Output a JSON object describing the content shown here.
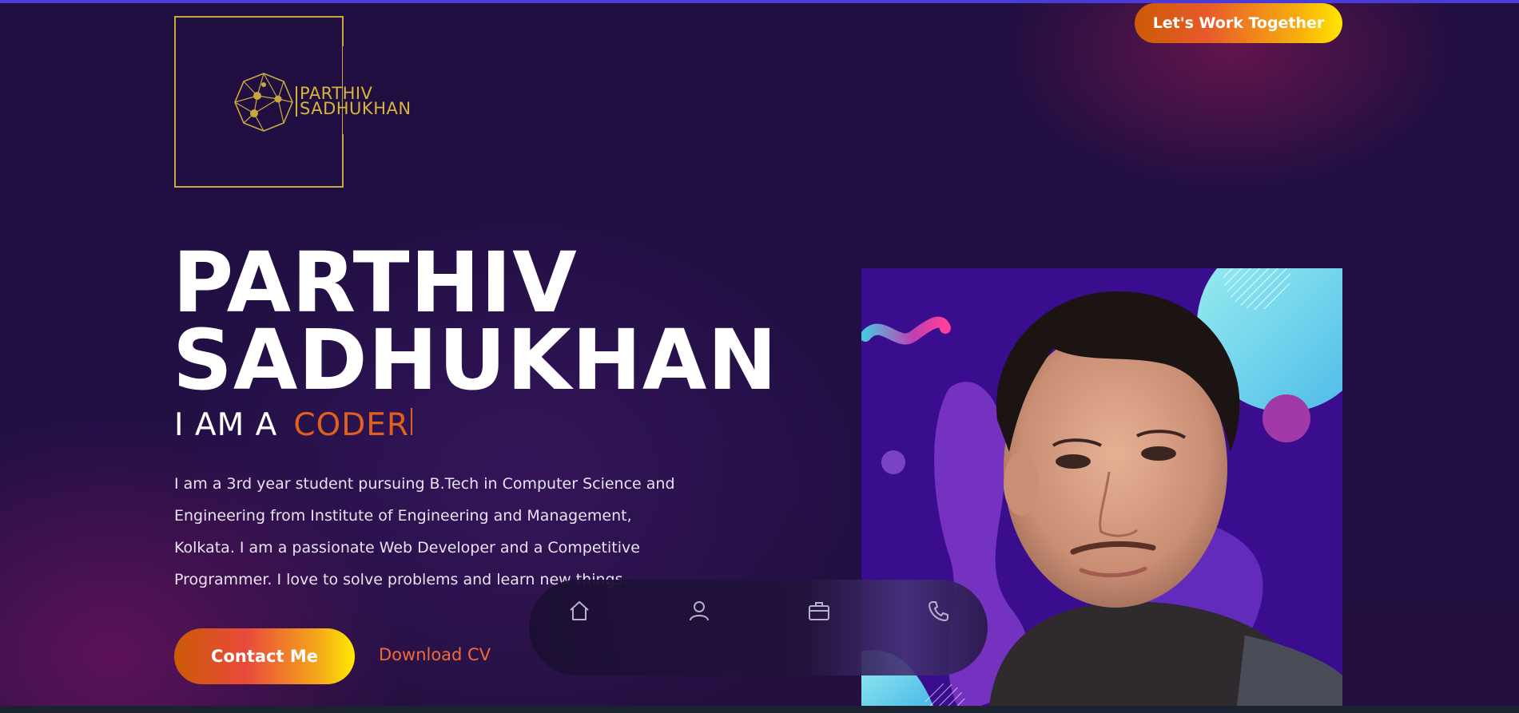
{
  "logo": {
    "line1": "PARTHIV",
    "line2": "SADHUKHAN",
    "icon": "geometric-network-icon",
    "color": "#d9b43a"
  },
  "header": {
    "cta_label": "Let's Work Together"
  },
  "hero": {
    "first_name": "PARTHIV",
    "last_name": "SADHUKHAN",
    "iam_prefix": "I AM A",
    "role": "CODER",
    "bio": "I am a 3rd year student pursuing B.Tech in Computer Science and Engineering from Institute of Engineering and Management, Kolkata. I am a passionate Web Developer and a Competitive Programmer. I love to solve problems and learn new things.",
    "contact_label": "Contact Me",
    "download_label": "Download CV"
  },
  "nav": {
    "items": [
      {
        "icon": "home-icon"
      },
      {
        "icon": "user-icon"
      },
      {
        "icon": "briefcase-icon"
      },
      {
        "icon": "phone-icon"
      }
    ]
  },
  "colors": {
    "background": "#1d0d3c",
    "accent_orange": "#e0601c",
    "gradient_end": "#ffe600",
    "logo_gold": "#c9a93c",
    "photo_bg": "#3a0d8f"
  }
}
